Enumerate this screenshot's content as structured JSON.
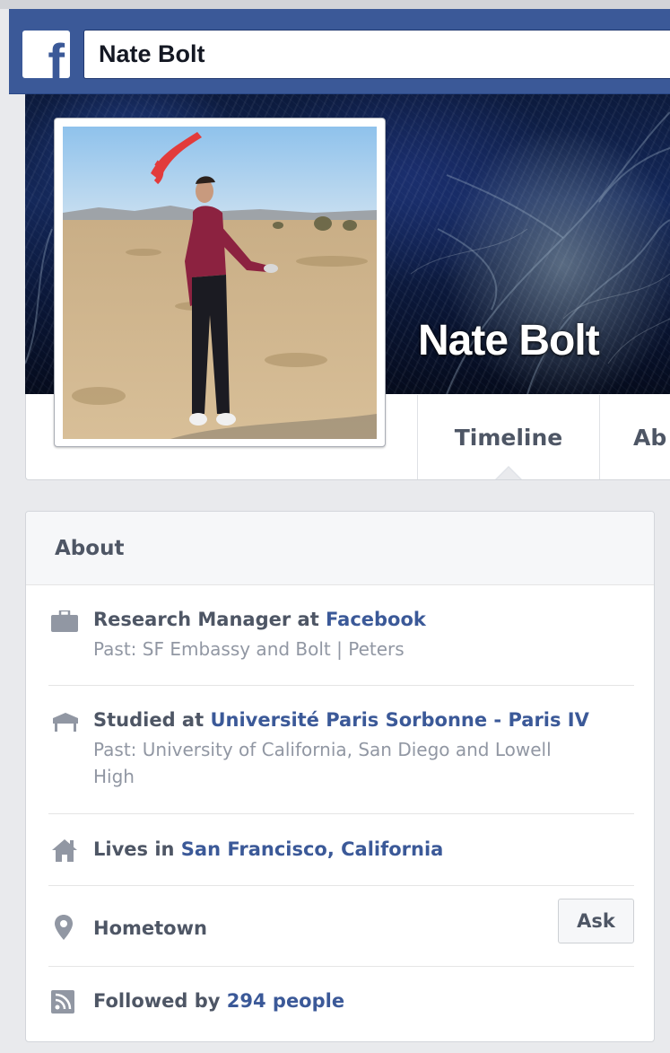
{
  "topbar": {
    "logo_letter": "f",
    "search_value": "Nate Bolt"
  },
  "profile": {
    "name": "Nate Bolt",
    "tabs": [
      {
        "label": "Timeline",
        "selected": true
      },
      {
        "label": "Ab"
      }
    ]
  },
  "about": {
    "title": "About",
    "work": {
      "prefix": "Research Manager at ",
      "link": "Facebook",
      "past": "Past: SF Embassy and Bolt | Peters"
    },
    "education": {
      "prefix": "Studied at ",
      "link": "Université Paris Sorbonne - Paris IV",
      "past_line1": "Past: University of California, San Diego and Lowell",
      "past_line2": "High"
    },
    "lives": {
      "prefix": "Lives in ",
      "link": "San Francisco, California"
    },
    "hometown": {
      "label": "Hometown",
      "button": "Ask"
    },
    "followers": {
      "prefix": "Followed by ",
      "link": "294 people"
    }
  },
  "colors": {
    "brand": "#3b5998",
    "text": "#4e5665",
    "muted": "#9197a3",
    "page_bg": "#e9eaed"
  }
}
